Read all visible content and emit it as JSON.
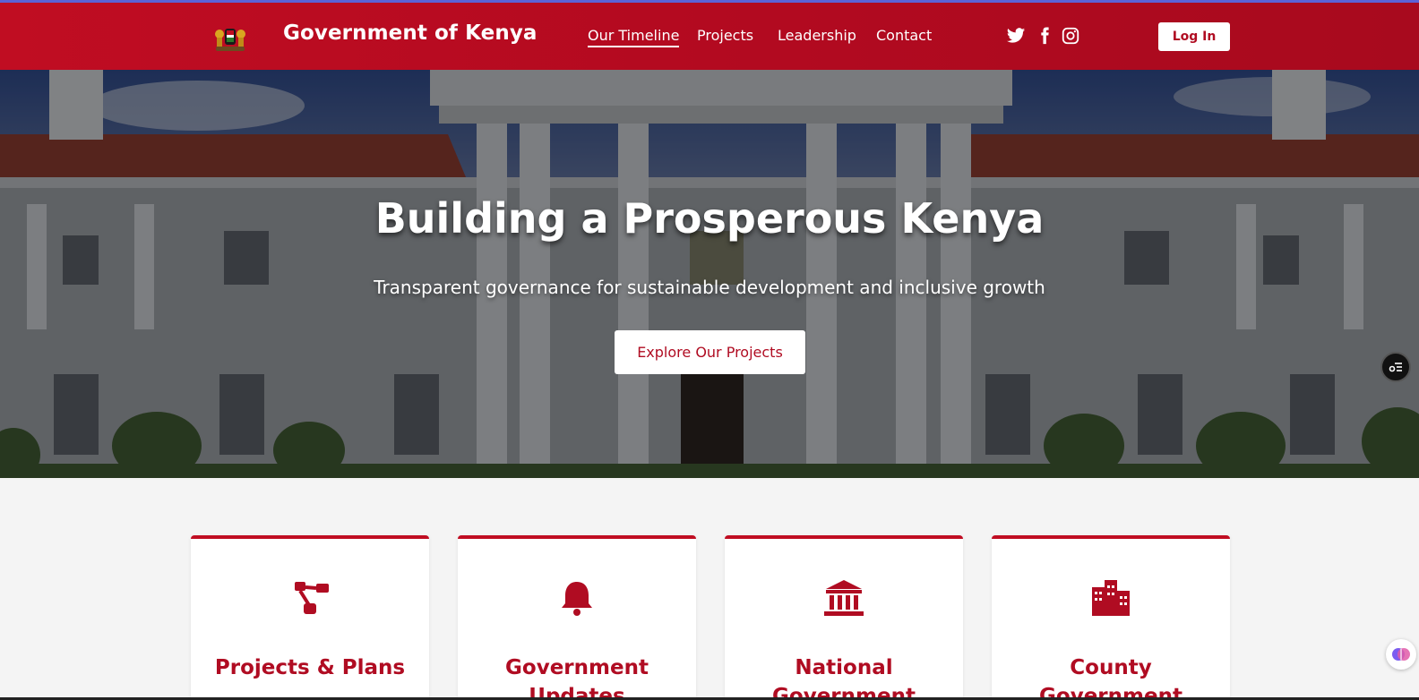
{
  "header": {
    "brand": "Government of Kenya",
    "nav": [
      {
        "label": "Our Timeline",
        "active": true
      },
      {
        "label": "Projects",
        "active": false
      },
      {
        "label": "Leadership",
        "active": false
      },
      {
        "label": "Contact",
        "active": false
      }
    ],
    "social": [
      "twitter-icon",
      "facebook-icon",
      "instagram-icon"
    ],
    "login_label": "Log In"
  },
  "hero": {
    "title": "Building a Prosperous Kenya",
    "subtitle": "Transparent governance for sustainable development and inclusive growth",
    "cta_label": "Explore Our Projects"
  },
  "cards": [
    {
      "icon": "project-diagram-icon",
      "title": "Projects & Plans"
    },
    {
      "icon": "bell-icon",
      "title": "Government Updates"
    },
    {
      "icon": "landmark-icon",
      "title": "National Government"
    },
    {
      "icon": "city-icon",
      "title": "County Government"
    }
  ],
  "colors": {
    "brand_red": "#c00d22",
    "accent_blue": "#5b63d8"
  }
}
